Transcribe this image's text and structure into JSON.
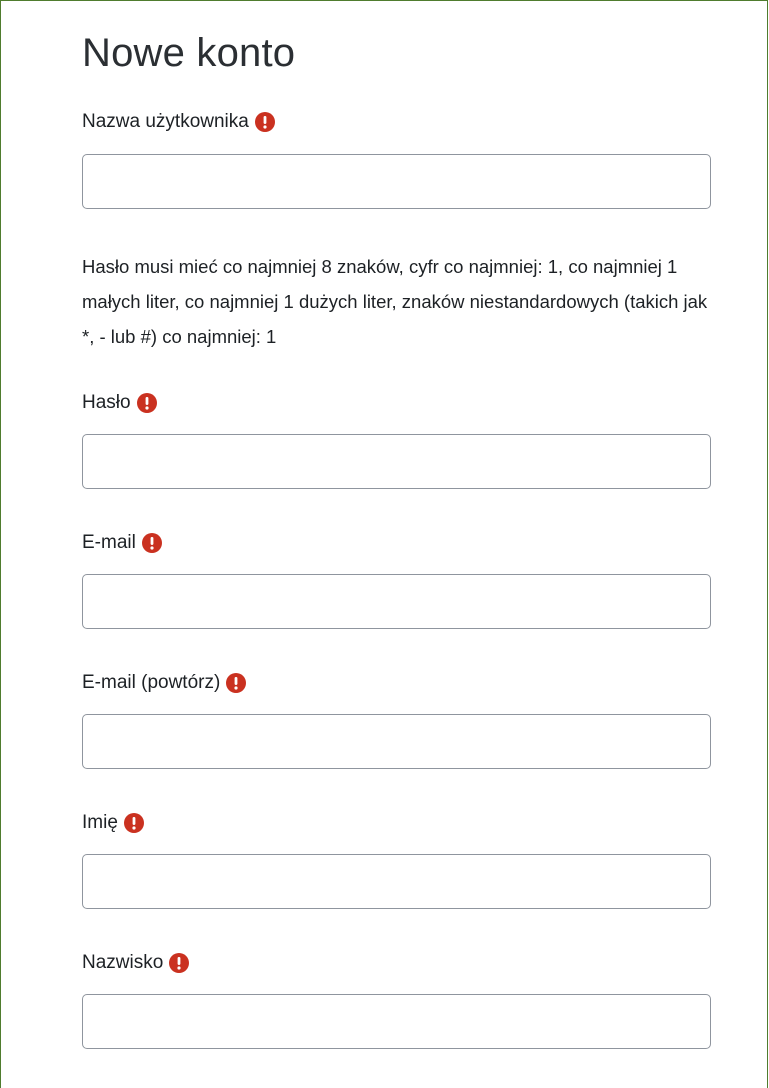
{
  "form": {
    "title": "Nowe konto",
    "password_policy": "Hasło musi mieć co najmniej 8 znaków, cyfr co najmniej: 1, co najmniej 1 małych liter, co najmniej 1 dużych liter, znaków niestandardowych (takich jak *, - lub #) co najmniej: 1",
    "required_icon": "exclamation-circle-icon",
    "required_color": "#ca3120",
    "border_color": "#4f7c2e",
    "fields": [
      {
        "label": "Nazwa użytkownika",
        "value": ""
      },
      {
        "label": "Hasło",
        "value": ""
      },
      {
        "label": "E-mail",
        "value": ""
      },
      {
        "label": "E-mail (powtórz)",
        "value": ""
      },
      {
        "label": "Imię",
        "value": ""
      },
      {
        "label": "Nazwisko",
        "value": ""
      }
    ]
  }
}
